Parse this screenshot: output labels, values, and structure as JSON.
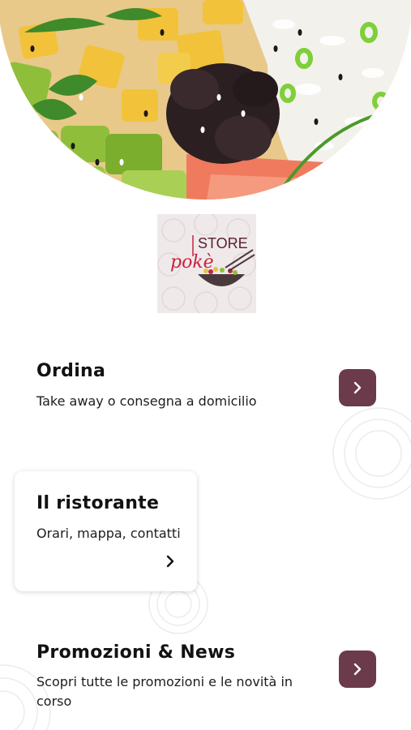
{
  "hero": {
    "image_name": "poke-bowl-photo"
  },
  "logo": {
    "word_store": "STORE",
    "word_poke": "pokè",
    "icon": "poke-store-logo"
  },
  "menu": [
    {
      "title": "Ordina",
      "subtitle": "Take away o consegna a domicilio",
      "icon": "chevron-right-icon"
    },
    {
      "title": "Il ristorante",
      "subtitle": "Orari, mappa, contatti",
      "icon": "chevron-right-icon"
    },
    {
      "title": "Promozioni & News",
      "subtitle": "Scopri tutte le promozioni e le novità in corso",
      "icon": "chevron-right-icon"
    }
  ],
  "colors": {
    "accent": "#6b3a4b",
    "logo_red": "#c8233c",
    "logo_bg": "#efe9ea"
  }
}
